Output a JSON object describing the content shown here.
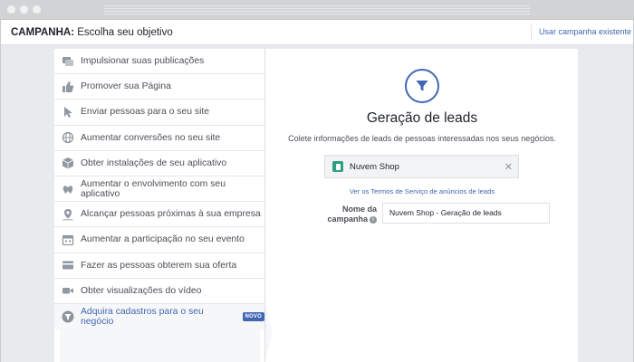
{
  "header": {
    "title_bold": "CAMPANHA:",
    "title_rest": " Escolha seu objetivo",
    "existing_link": "Usar campanha existente"
  },
  "sidebar": {
    "items": [
      {
        "label": "Impulsionar suas publicações",
        "icon": "boost-posts-icon"
      },
      {
        "label": "Promover sua Página",
        "icon": "thumbs-up-icon"
      },
      {
        "label": "Enviar pessoas para o seu site",
        "icon": "cursor-icon"
      },
      {
        "label": "Aumentar conversões no seu site",
        "icon": "globe-icon"
      },
      {
        "label": "Obter instalações de seu aplicativo",
        "icon": "box-icon"
      },
      {
        "label": "Aumentar o envolvimento com seu aplicativo",
        "icon": "gamepad-icon"
      },
      {
        "label": "Alcançar pessoas próximas à sua empresa",
        "icon": "location-pin-icon"
      },
      {
        "label": "Aumentar a participação no seu evento",
        "icon": "calendar-icon"
      },
      {
        "label": "Fazer as pessoas obterem sua oferta",
        "icon": "offer-card-icon"
      },
      {
        "label": "Obter visualizações do vídeo",
        "icon": "video-camera-icon"
      },
      {
        "label": "Adquira cadastros para o seu negócio",
        "icon": "funnel-icon",
        "badge": "NOVO",
        "active": true
      }
    ]
  },
  "main": {
    "objective_title": "Geração de leads",
    "objective_desc": "Colete informações de leads de pessoas interessadas nos seus negócios.",
    "page_name": "Nuvem Shop",
    "terms_link": "Ver os Termos de Serviço de anúncios de leads",
    "name_label_line1": "Nome da",
    "name_label_line2": "campanha",
    "campaign_name": "Nuvem Shop - Geração de leads"
  },
  "colors": {
    "accent": "#4267b2",
    "page_icon": "#2e9e84"
  }
}
